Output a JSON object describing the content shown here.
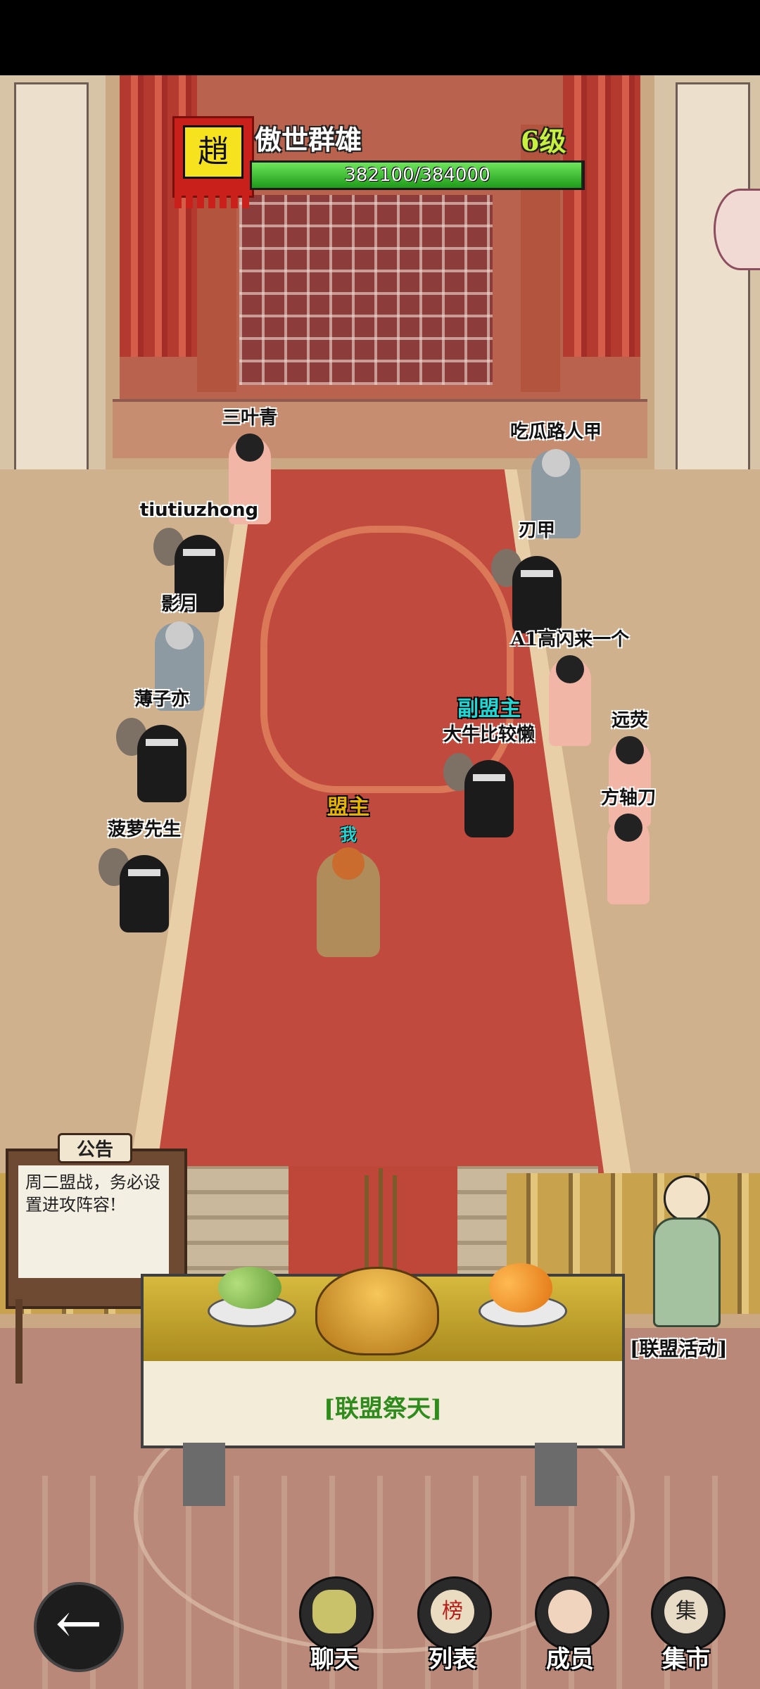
{
  "header": {
    "banner_char": "趙",
    "guild_name": "傲世群雄",
    "level": "6级",
    "exp_text": "382100/384000",
    "exp_progress": 0.995
  },
  "characters": [
    {
      "name": "三叶青",
      "type": "lady"
    },
    {
      "name": "tiutiuzhong",
      "type": "ninja"
    },
    {
      "name": "影月",
      "type": "armor"
    },
    {
      "name": "薄子亦",
      "type": "ninja"
    },
    {
      "name": "菠萝先生",
      "type": "ninja"
    },
    {
      "name": "吃瓜路人甲",
      "type": "armor"
    },
    {
      "name": "刃甲",
      "type": "ninja"
    },
    {
      "name": "A1高闪来一个",
      "type": "lady"
    },
    {
      "name": "大牛比较懒",
      "title": "副盟主",
      "type": "ninja"
    },
    {
      "name": "远荧",
      "type": "lady"
    },
    {
      "name": "方轴刀",
      "type": "lady"
    }
  ],
  "leader": {
    "title": "盟主",
    "tag": "我"
  },
  "notice": {
    "title": "公告",
    "text": "周二盟战，务必设置进攻阵容!"
  },
  "altar": {
    "label": "[联盟祭天]"
  },
  "activity": {
    "label": "[联盟活动]"
  },
  "nav": {
    "back_icon": "←",
    "items": [
      {
        "label": "聊天",
        "icon": "chat-icon"
      },
      {
        "label": "列表",
        "icon": "list-icon",
        "badge": "榜"
      },
      {
        "label": "成员",
        "icon": "members-icon"
      },
      {
        "label": "集市",
        "icon": "market-icon",
        "badge": "集"
      }
    ]
  }
}
